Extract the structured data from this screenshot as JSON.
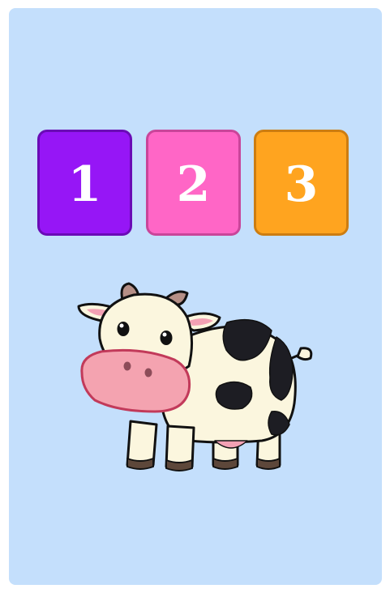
{
  "cards": [
    {
      "label": "1",
      "color": "#9616f6",
      "border": "#6a0bb6"
    },
    {
      "label": "2",
      "color": "#ff66c6",
      "border": "#c9459a"
    },
    {
      "label": "3",
      "color": "#ffa41f",
      "border": "#cd7d11"
    }
  ],
  "colors": {
    "panel": "#c4dffc",
    "page": "#ffffff"
  },
  "image": {
    "icon": "cow-icon"
  }
}
